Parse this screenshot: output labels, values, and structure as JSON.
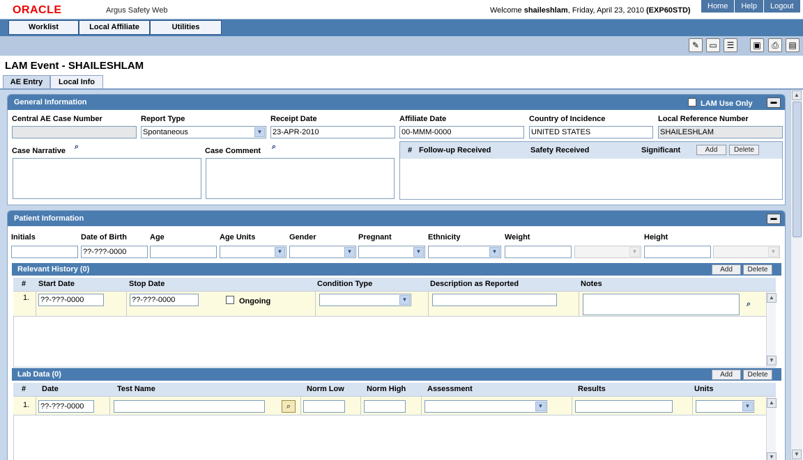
{
  "header": {
    "logo": "ORACLE",
    "app_name": "Argus Safety Web",
    "welcome_prefix": "Welcome",
    "user": "shaileshlam",
    "date": ", Friday, April 23, 2010",
    "server": "(EXP60STD)",
    "links": [
      "Home",
      "Help",
      "Logout"
    ]
  },
  "menu": [
    "Worklist",
    "Local Affiliate",
    "Utilities"
  ],
  "toolbar_icons": [
    "new-document-icon",
    "open-folder-icon",
    "list-icon",
    "folder-lock-icon",
    "print-icon",
    "save-icon"
  ],
  "page_title": "LAM Event - SHAILESHLAM",
  "tabs": [
    "AE Entry",
    "Local Info"
  ],
  "general": {
    "title": "General Information",
    "lam_use_only": "LAM Use Only",
    "labels": {
      "case_number": "Central AE Case Number",
      "report_type": "Report Type",
      "receipt_date": "Receipt Date",
      "affiliate_date": "Affiliate Date",
      "country": "Country of Incidence",
      "local_ref": "Local Reference Number",
      "narrative": "Case Narrative",
      "comment": "Case Comment"
    },
    "values": {
      "case_number": "",
      "report_type": "Spontaneous",
      "receipt_date": "23-APR-2010",
      "affiliate_date": "00-MMM-0000",
      "country": "UNITED STATES",
      "local_ref": "SHAILESHLAM"
    },
    "followup": {
      "cols": [
        "#",
        "Follow-up Received",
        "Safety Received",
        "Significant"
      ],
      "add": "Add",
      "delete": "Delete"
    }
  },
  "patient": {
    "title": "Patient Information",
    "labels": [
      "Initials",
      "Date of Birth",
      "Age",
      "Age Units",
      "Gender",
      "Pregnant",
      "Ethnicity",
      "Weight",
      "Height"
    ],
    "dob_value": "??-???-0000"
  },
  "history": {
    "title": "Relevant History (0)",
    "add": "Add",
    "delete": "Delete",
    "cols": [
      "#",
      "Start Date",
      "Stop Date",
      "Condition Type",
      "Description as Reported",
      "Notes"
    ],
    "row": {
      "num": "1.",
      "start": "??-???-0000",
      "stop": "??-???-0000",
      "ongoing": "Ongoing"
    }
  },
  "lab": {
    "title": "Lab Data (0)",
    "add": "Add",
    "delete": "Delete",
    "cols": [
      "#",
      "Date",
      "Test Name",
      "Norm Low",
      "Norm High",
      "Assessment",
      "Results",
      "Units"
    ],
    "row": {
      "num": "1.",
      "date": "??-???-0000"
    }
  },
  "colors": {
    "header_blue": "#4a7cb0",
    "toolbar": "#b5c8e0",
    "row_bg": "#fcfbe0",
    "logo_red": "#ee0000"
  }
}
